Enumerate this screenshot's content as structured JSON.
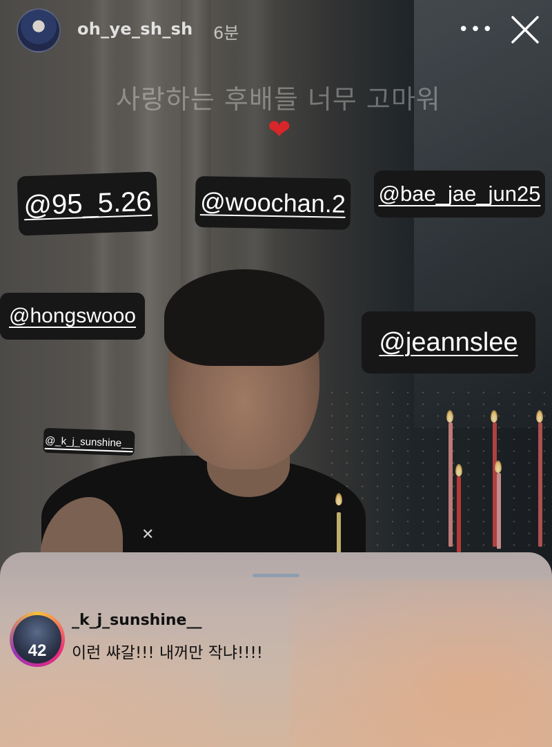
{
  "header": {
    "username": "oh_ye_sh_sh",
    "time": "6분"
  },
  "story": {
    "caption": "사랑하는 후배들 너무 고마워",
    "heart": "❤",
    "mentions": [
      "@95_5.26",
      "@woochan.2",
      "@bae_jae_jun25",
      "@hongswooo",
      "@jeannslee",
      "@_k_j_sunshine__"
    ]
  },
  "reply": {
    "username": "_k_j_sunshine__",
    "text": "이런 쌰갈!!! 내꺼만 작냐!!!!",
    "avatar_badge": "42"
  },
  "icons": {
    "more": "more-horizontal-icon",
    "close": "close-icon",
    "heart": "heart-icon"
  },
  "colors": {
    "heart": "#d8262a",
    "mention_bg": "#171717",
    "story_ring": [
      "#f9c13a",
      "#ee2a7b",
      "#9b36b7"
    ]
  }
}
